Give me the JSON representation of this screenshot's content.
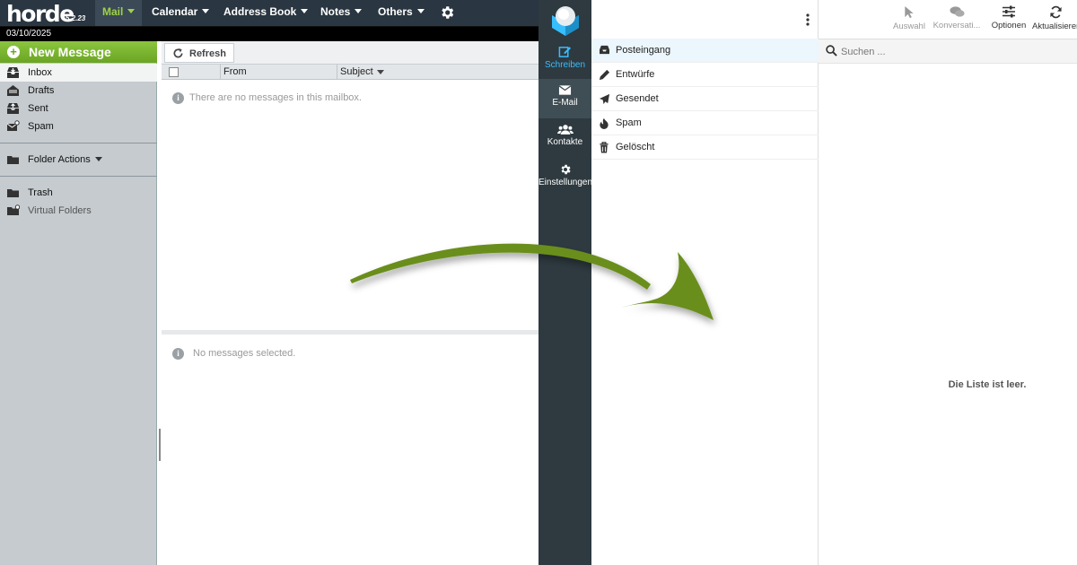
{
  "horde": {
    "logo": "horde",
    "version": "5.2.23",
    "nav": {
      "mail": "Mail",
      "calendar": "Calendar",
      "address_book": "Address Book",
      "notes": "Notes",
      "others": "Others"
    },
    "date": "03/10/2025",
    "new_message": "New Message",
    "folders": {
      "inbox": "Inbox",
      "drafts": "Drafts",
      "sent": "Sent",
      "spam": "Spam",
      "folder_actions": "Folder Actions",
      "trash": "Trash",
      "virtual_folders": "Virtual Folders"
    },
    "toolbar": {
      "refresh": "Refresh"
    },
    "columns": {
      "from": "From",
      "subject": "Subject"
    },
    "empty_list": "There are no messages in this mailbox.",
    "no_selection": "No messages selected."
  },
  "roundcube": {
    "nav": {
      "compose": "Schreiben",
      "mail": "E-Mail",
      "contacts": "Kontakte",
      "settings": "Einstellungen"
    },
    "folders": {
      "inbox": "Posteingang",
      "drafts": "Entwürfe",
      "sent": "Gesendet",
      "spam": "Spam",
      "trash": "Gelöscht"
    },
    "toolbar": {
      "select": "Auswahl",
      "threads": "Konversati...",
      "options": "Optionen",
      "refresh": "Aktualisieren"
    },
    "search_placeholder": "Suchen ...",
    "empty_list": "Die Liste ist leer."
  },
  "colors": {
    "horde_topbar": "#2a3641",
    "horde_green": "#6aa521",
    "horde_sidebar": "#c5cbcf",
    "roundcube_nav": "#2e3a40",
    "roundcube_accent": "#37beff",
    "arrow": "#6b8e1e"
  }
}
